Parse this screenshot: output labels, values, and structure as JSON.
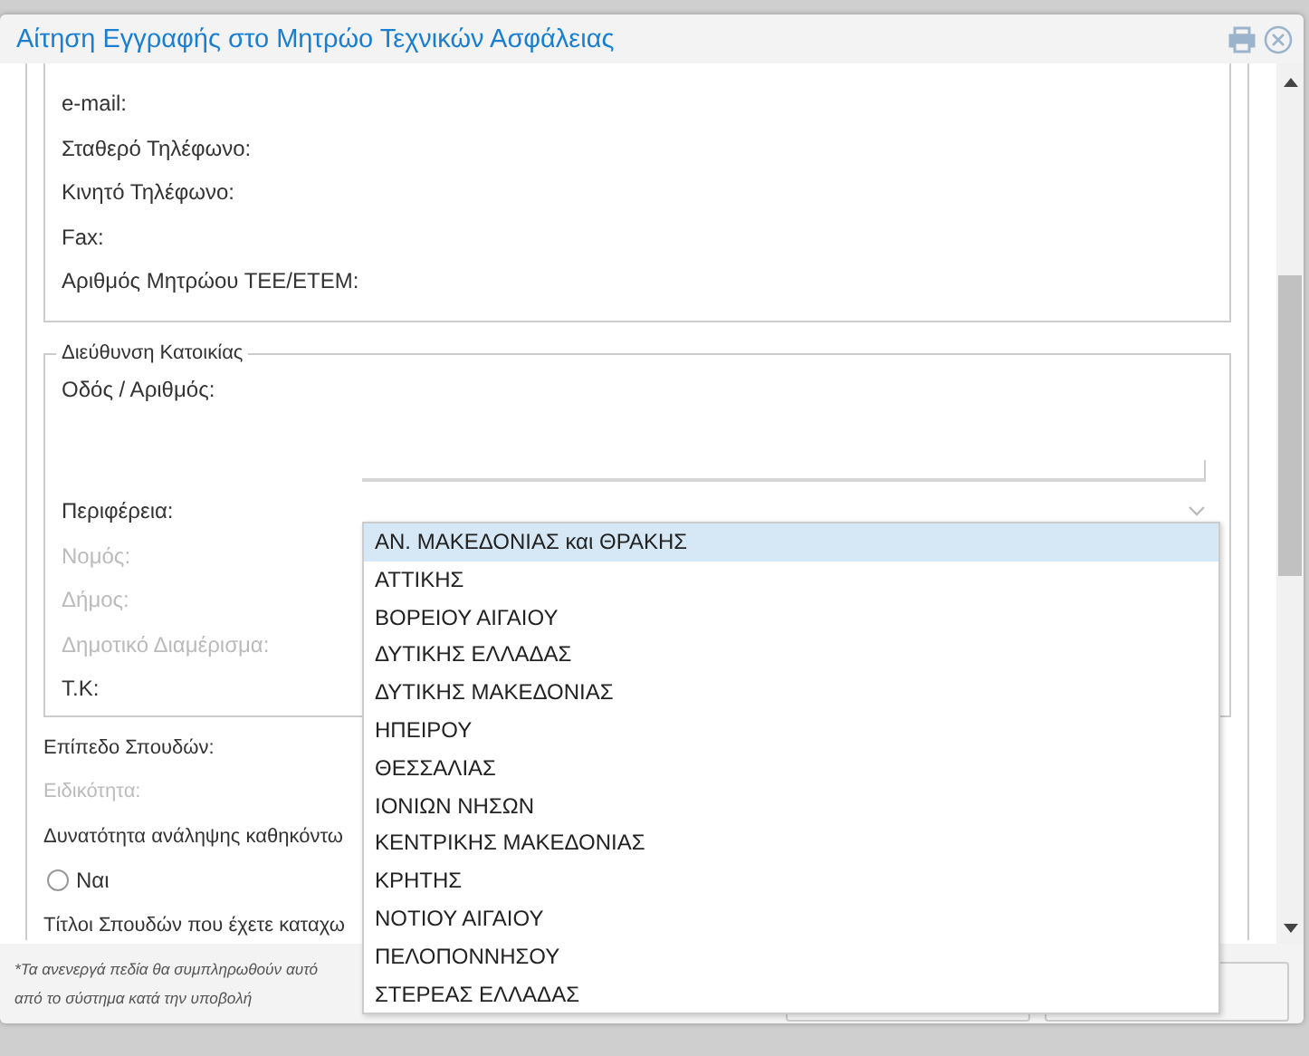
{
  "window": {
    "title": "Αίτηση Εγγραφής στο Μητρώο Τεχνικών Ασφάλειας"
  },
  "contact_fields": [
    {
      "label": "e-mail:",
      "disabled": false
    },
    {
      "label": "Σταθερό Τηλέφωνο:",
      "disabled": false
    },
    {
      "label": "Κινητό Τηλέφωνο:",
      "disabled": false
    },
    {
      "label": "Fax:",
      "disabled": false
    },
    {
      "label": "Αριθμός Μητρώου ΤΕΕ/ΕΤΕΜ:",
      "disabled": false
    }
  ],
  "address": {
    "legend": "Διεύθυνση Κατοικίας",
    "fields": [
      {
        "label": "Οδός / Αριθμός:",
        "kind": "textarea",
        "disabled": false
      },
      {
        "label": "Περιφέρεια:",
        "kind": "select",
        "disabled": false
      },
      {
        "label": "Νομός:",
        "kind": "text",
        "disabled": true
      },
      {
        "label": "Δήμος:",
        "kind": "text",
        "disabled": true
      },
      {
        "label": "Δημοτικό Διαμέρισμα:",
        "kind": "text",
        "disabled": true
      },
      {
        "label": "Τ.Κ:",
        "kind": "text",
        "disabled": false
      }
    ]
  },
  "education_fields": [
    {
      "label": "Επίπεδο Σπουδών:",
      "kind": "text",
      "disabled": false
    },
    {
      "label": "Ειδικότητα:",
      "kind": "text",
      "disabled": true
    },
    {
      "label": "Δυνατότητα ανάληψης καθηκόντω",
      "kind": "text",
      "disabled": false
    },
    {
      "label": "Ναι",
      "kind": "radio",
      "selected": false,
      "disabled": false
    },
    {
      "label": "Τίτλοι Σπουδών που έχετε καταχω",
      "kind": "text",
      "disabled": false
    }
  ],
  "footer_note": "*Τα ανενεργά πεδία θα συμπληρωθούν αυτό\nαπό το σύστημα κατά την υποβολή",
  "dropdown_options": [
    {
      "label": "ΑΝ. ΜΑΚΕΔΟΝΙΑΣ και ΘΡΑΚΗΣ",
      "selected": true
    },
    {
      "label": "ΑΤΤΙΚΗΣ",
      "selected": false
    },
    {
      "label": "ΒΟΡΕΙΟΥ ΑΙΓΑΙΟΥ",
      "selected": false
    },
    {
      "label": "ΔΥΤΙΚΗΣ ΕΛΛΑΔΑΣ",
      "selected": false
    },
    {
      "label": "ΔΥΤΙΚΗΣ ΜΑΚΕΔΟΝΙΑΣ",
      "selected": false
    },
    {
      "label": "ΗΠΕΙΡΟΥ",
      "selected": false
    },
    {
      "label": "ΘΕΣΣΑΛΙΑΣ",
      "selected": false
    },
    {
      "label": "ΙΟΝΙΩΝ ΝΗΣΩΝ",
      "selected": false
    },
    {
      "label": "ΚΕΝΤΡΙΚΗΣ ΜΑΚΕΔΟΝΙΑΣ",
      "selected": false
    },
    {
      "label": "ΚΡΗΤΗΣ",
      "selected": false
    },
    {
      "label": "ΝΟΤΙΟΥ ΑΙΓΑΙΟΥ",
      "selected": false
    },
    {
      "label": "ΠΕΛΟΠΟΝΝΗΣΟΥ",
      "selected": false
    },
    {
      "label": "ΣΤΕΡΕΑΣ ΕΛΛΑΔΑΣ",
      "selected": false
    }
  ]
}
